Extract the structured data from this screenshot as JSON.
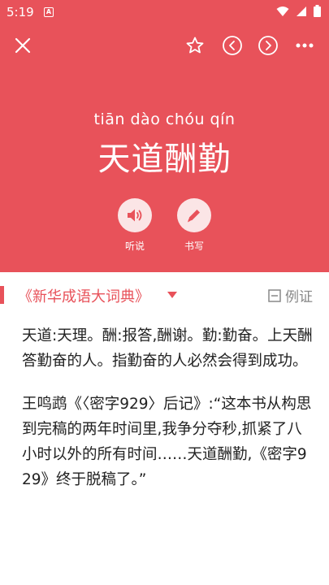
{
  "status_bar": {
    "time": "5:19",
    "notification_letter": "A",
    "icons": [
      "wifi-icon",
      "signal-icon",
      "battery-icon"
    ]
  },
  "toolbar": {
    "icons": [
      "close-icon",
      "star-icon",
      "prev-icon",
      "next-icon",
      "more-icon"
    ]
  },
  "entry": {
    "pinyin": "tiān dào chóu qín",
    "idiom": "天道酬勤"
  },
  "actions": {
    "listen_label": "听说",
    "write_label": "书写"
  },
  "source": {
    "name": "《新华成语大词典》",
    "example_label": "例证"
  },
  "content": {
    "definition": "天道:天理。酬:报答,酬谢。勤:勤奋。上天酬答勤奋的人。指勤奋的人必然会得到成功。",
    "quote": "王鸣鹉《〈密字929〉后记》:“这本书从构思到完稿的两年时间里,我争分夺秒,抓紧了八小时以外的所有时间……天道酬勤,《密字929》终于脱稿了。”"
  },
  "colors": {
    "accent": "#e8525a",
    "action_bg": "#fbe5e6",
    "text": "#222222",
    "muted": "#888888"
  }
}
